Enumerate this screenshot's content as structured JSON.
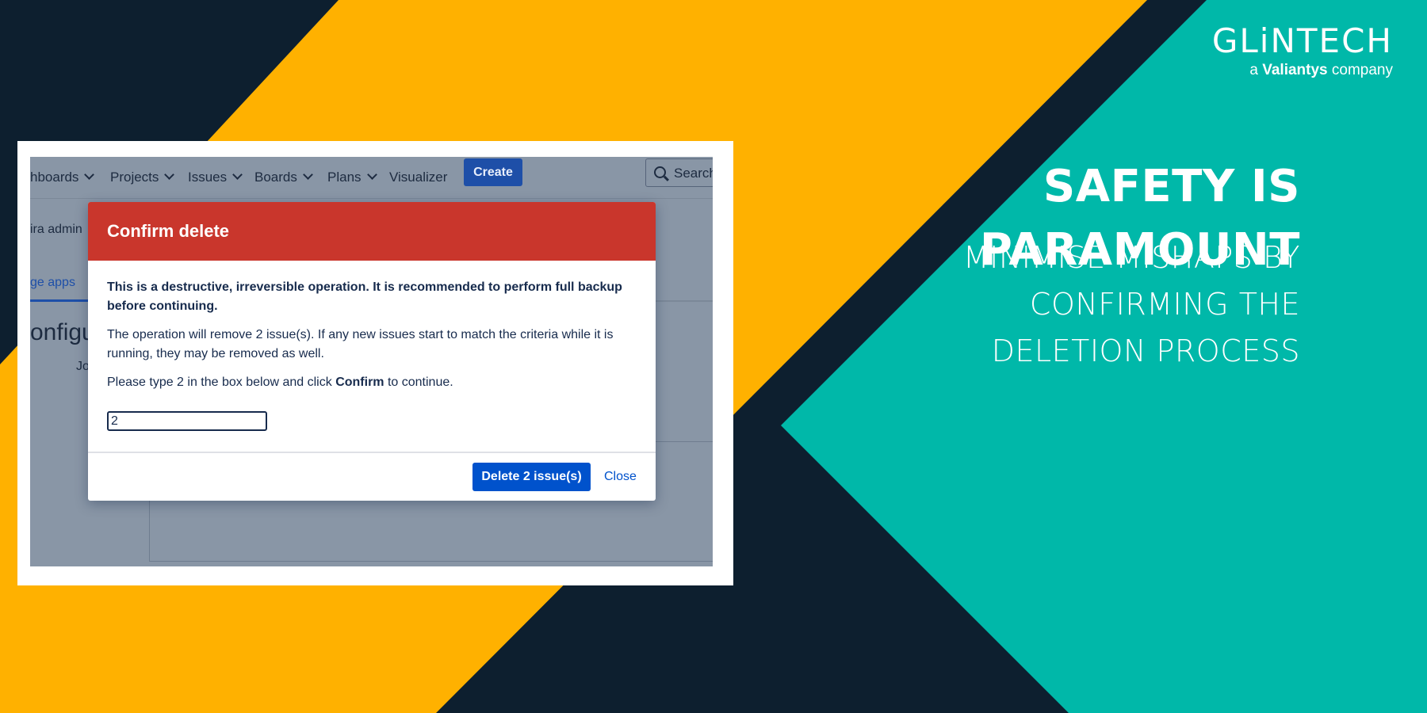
{
  "brand": {
    "logo_text": "GLiNTECH",
    "tagline_prefix": "a",
    "tagline_brand": "Valiantys",
    "tagline_suffix": "company"
  },
  "headline": "SAFETY IS PARAMOUNT",
  "subheadline": [
    "MINIMISE MISHAPS BY",
    "CONFIRMING THE",
    "DELETION PROCESS"
  ],
  "colors": {
    "navy": "#0d1f2f",
    "yellow": "#ffb100",
    "teal": "#00b8a9",
    "modal_header_red": "#c9362c",
    "primary_blue": "#0052cc"
  },
  "jira": {
    "nav_items": [
      "hboards",
      "Projects",
      "Issues",
      "Boards",
      "Plans",
      "Visualizer"
    ],
    "create_label": "Create",
    "search_placeholder": "Search",
    "sidebar_text": "ira admin",
    "tab_label": "ge apps",
    "page_heading": "onfigu",
    "small_text": "Jo"
  },
  "modal": {
    "title": "Confirm delete",
    "warning": "This is a destructive, irreversible operation. It is recommended to perform full backup before continuing.",
    "info": "The operation will remove 2 issue(s). If any new issues start to match the criteria while it is running, they may be removed as well.",
    "instruction_prefix": "Please type 2 in the box below and click",
    "instruction_bold": "Confirm",
    "instruction_suffix": "to continue.",
    "input_value": "2",
    "delete_label": "Delete 2 issue(s)",
    "close_label": "Close"
  }
}
